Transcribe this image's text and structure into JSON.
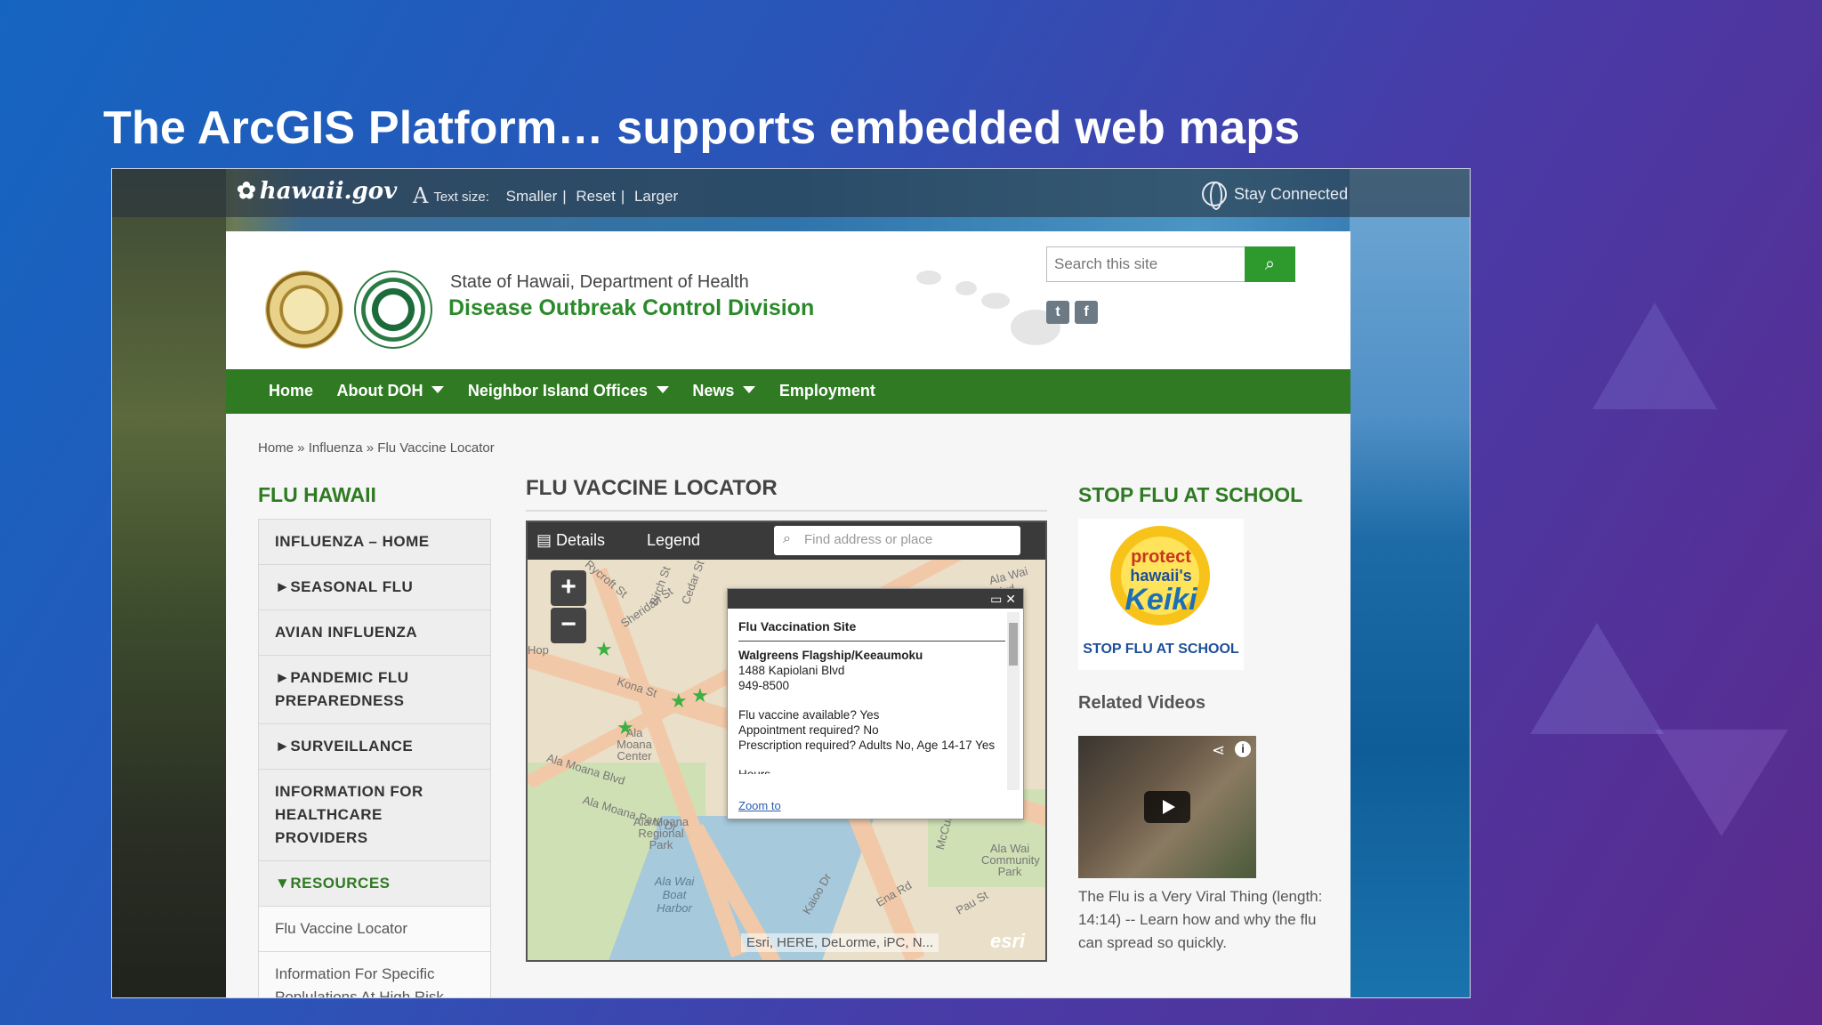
{
  "slide_title": "The ArcGIS Platform… supports embedded web maps",
  "topbar": {
    "logo": "hawaii.gov",
    "text_size_label": "Text size:",
    "smaller": "Smaller",
    "reset": "Reset",
    "larger": "Larger",
    "stay_connected": "Stay Connected"
  },
  "header": {
    "dept": "State of Hawaii, Department of Health",
    "division": "Disease Outbreak Control Division",
    "search_placeholder": "Search this site"
  },
  "nav": {
    "items": [
      "Home",
      "About DOH",
      "Neighbor Island Offices",
      "News",
      "Employment"
    ]
  },
  "breadcrumb": {
    "home": "Home",
    "influenza": "Influenza",
    "current": "Flu Vaccine Locator"
  },
  "left": {
    "title": "FLU HAWAII",
    "items": [
      "INFLUENZA – HOME",
      "►SEASONAL FLU",
      "AVIAN INFLUENZA",
      "►PANDEMIC FLU PREPAREDNESS",
      "►SURVEILLANCE",
      "INFORMATION FOR HEALTHCARE PROVIDERS",
      "▼RESOURCES",
      "Flu Vaccine Locator",
      "Information For Specific Poplulations At High Risk"
    ]
  },
  "main": {
    "title": "FLU VACCINE LOCATOR",
    "map": {
      "details": "Details",
      "legend": "Legend",
      "find_placeholder": "Find address or place",
      "attribution": "Esri, HERE, DeLorme, iPC, N...",
      "esri_logo": "esri",
      "labels": [
        "Kona St",
        "Sheridan St",
        "Birch St",
        "Cedar St",
        "Ala Moana Blvd",
        "Ala Moana Center",
        "Ala Moana Regional Park",
        "Ala Wai Boat Harbor",
        "Ala Wai Community Park",
        "McCully St",
        "Kaioo Dr",
        "Ena Rd",
        "Pau St",
        "Ala Moana Park Dr",
        "Hop",
        "Rycroft St",
        "Ala Wai Blvd"
      ],
      "popup": {
        "title": "Flu Vaccination Site",
        "name": "Walgreens Flagship/Keeaumoku",
        "address": "1488 Kapiolani Blvd",
        "phone": "949-8500",
        "q1": "Flu vaccine available?   Yes",
        "q2": "Appointment required?  No",
        "q3": "Prescription required?   Adults No, Age 14-17 Yes",
        "q4": "Hours",
        "zoom_to": "Zoom to"
      }
    }
  },
  "right": {
    "title": "STOP FLU AT SCHOOL",
    "keiki": {
      "protect": "protect",
      "hawaiis": "hawaii's",
      "keiki": "Keiki",
      "stop": "STOP FLU AT SCHOOL"
    },
    "related_videos": "Related Videos",
    "video_desc": "The Flu is a Very Viral Thing (length: 14:14) -- Learn how and why the flu can spread so quickly."
  },
  "colors": {
    "nav_green": "#2f7a22",
    "title_green": "#2a8a2a",
    "search_button": "#2e9a2e"
  }
}
